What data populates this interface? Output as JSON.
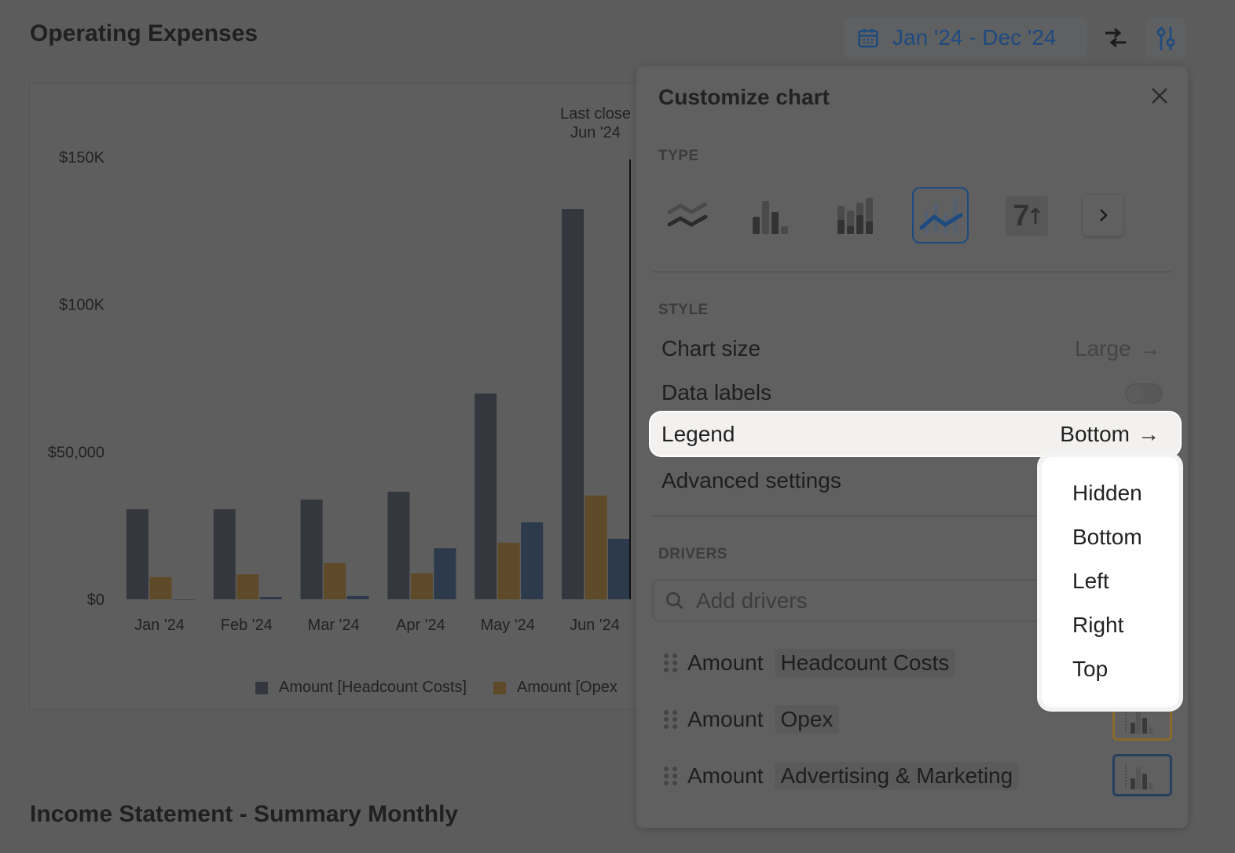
{
  "header": {
    "title": "Operating Expenses",
    "date_range": "Jan '24 - Dec '24"
  },
  "second_title": "Income Statement - Summary Monthly",
  "chart_data": {
    "type": "bar",
    "categories": [
      "Jan '24",
      "Feb '24",
      "Mar '24",
      "Apr '24",
      "May '24",
      "Jun '24"
    ],
    "series": [
      {
        "name": "Amount [Headcount Costs]",
        "values": [
          30600,
          30600,
          33800,
          36500,
          69800,
          132400
        ],
        "color": "#34383e"
      },
      {
        "name": "Amount [Opex]",
        "values": [
          7500,
          8500,
          12300,
          8800,
          19200,
          35200
        ],
        "color": "#5e4a28"
      },
      {
        "name": "Amount [Advertising & Marketing]",
        "values": [
          0,
          800,
          1100,
          17300,
          26100,
          20500
        ],
        "color": "#2c3a4c"
      }
    ],
    "yticks": [
      "$0",
      "$50,000",
      "$100K",
      "$150K"
    ],
    "ytick_values": [
      0,
      50000,
      100000,
      150000
    ],
    "ylim": [
      0,
      150000
    ],
    "annotation": {
      "label1": "Last close",
      "label2": "Jun '24"
    },
    "legend_position": "bottom",
    "legend": [
      "Amount [Headcount Costs]",
      "Amount [Opex"
    ]
  },
  "panel": {
    "title": "Customize chart",
    "type_label": "TYPE",
    "types": [
      "multi-line",
      "bar",
      "stacked-bar",
      "bar-line-combo",
      "number"
    ],
    "selected_type": "bar-line-combo",
    "type_number_glyph": "7",
    "style_label": "STYLE",
    "chart_size_label": "Chart size",
    "chart_size_value": "Large",
    "data_labels_label": "Data labels",
    "data_labels_on": false,
    "legend_label": "Legend",
    "legend_value": "Bottom",
    "advanced_label": "Advanced settings",
    "drivers_label": "DRIVERS",
    "add_placeholder": "Add drivers",
    "drivers": [
      {
        "prefix": "Amount",
        "name": "Headcount Costs",
        "color": "#34383e"
      },
      {
        "prefix": "Amount",
        "name": "Opex",
        "color": "#8a6a2a"
      },
      {
        "prefix": "Amount",
        "name": "Advertising & Marketing",
        "color": "#26405e"
      }
    ]
  },
  "legend_options": [
    "Hidden",
    "Bottom",
    "Left",
    "Right",
    "Top"
  ]
}
